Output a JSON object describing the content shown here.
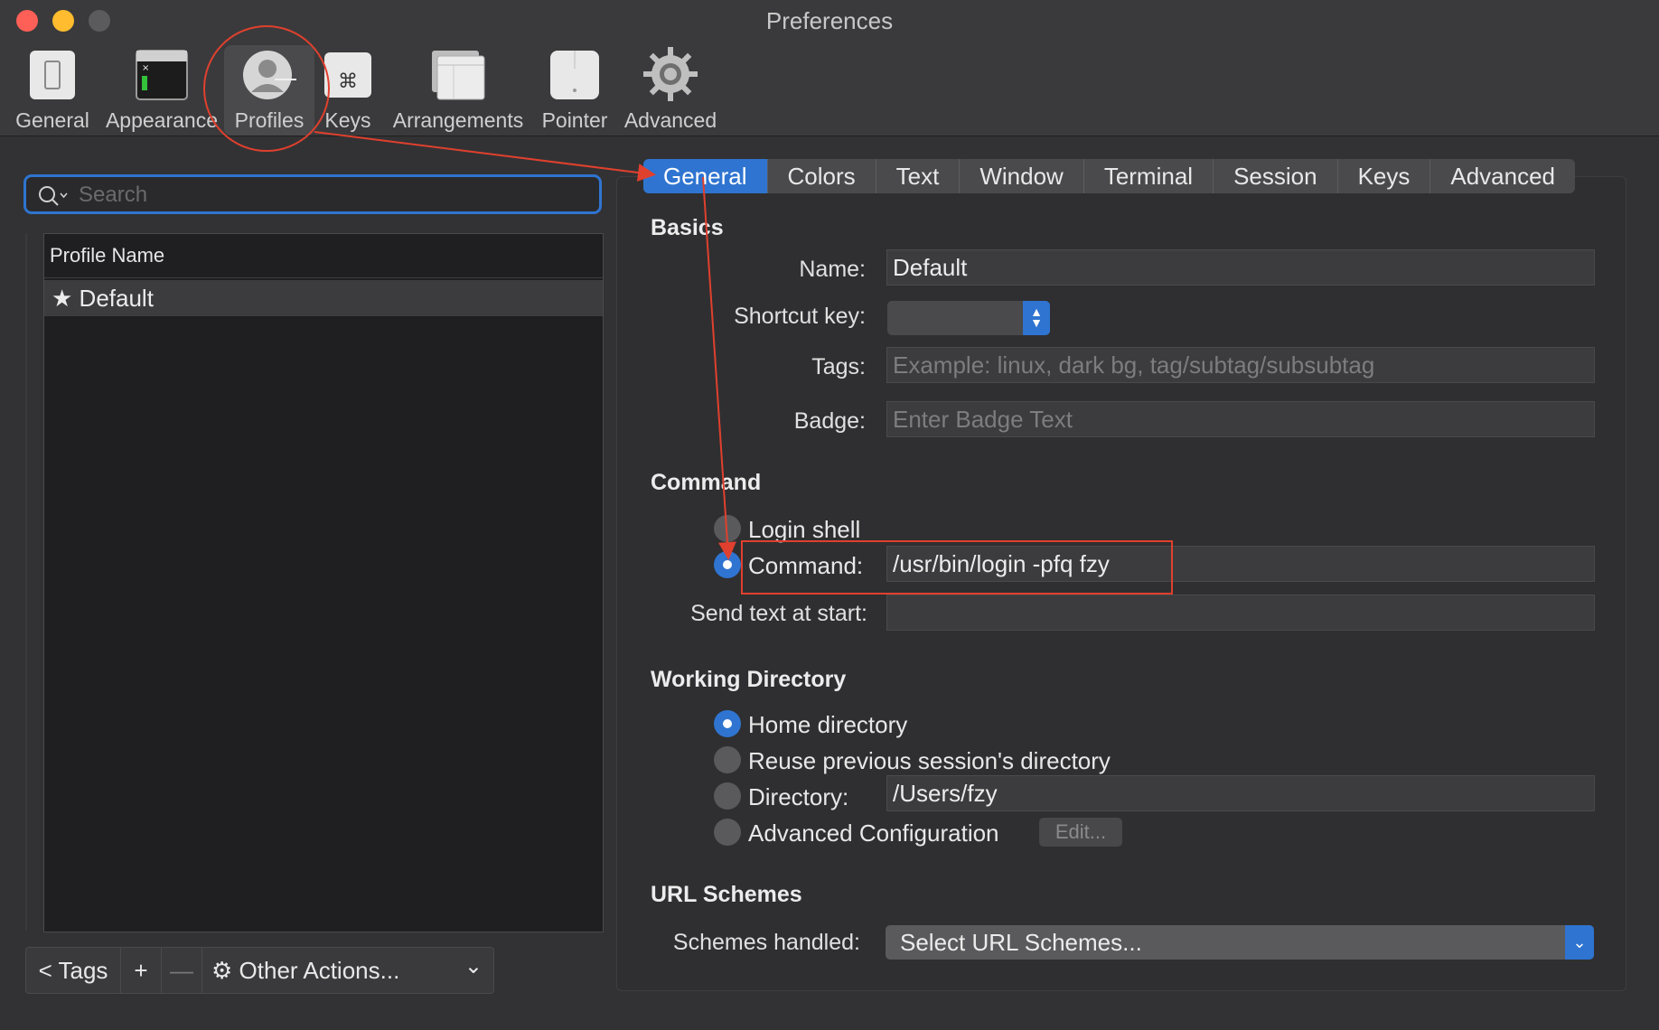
{
  "window": {
    "title": "Preferences"
  },
  "toolbar": {
    "items": [
      {
        "label": "General",
        "icon": "general-switch-icon"
      },
      {
        "label": "Appearance",
        "icon": "appearance-window-icon"
      },
      {
        "label": "Profiles",
        "icon": "profile-person-icon"
      },
      {
        "label": "Keys",
        "icon": "command-key-icon"
      },
      {
        "label": "Arrangements",
        "icon": "arrangements-windows-icon"
      },
      {
        "label": "Pointer",
        "icon": "mouse-pointer-icon"
      },
      {
        "label": "Advanced",
        "icon": "gear-icon"
      }
    ],
    "selected": "Profiles"
  },
  "sidebar": {
    "search_placeholder": "Search",
    "column_header": "Profile Name",
    "profiles": [
      {
        "name": "Default",
        "default_star": "★"
      }
    ],
    "bottom": {
      "tags_label": "< Tags",
      "add_label": "+",
      "remove_label": "—",
      "other_actions_label": "Other Actions...",
      "other_actions_chevron": "⌄"
    }
  },
  "tabs": {
    "items": [
      "General",
      "Colors",
      "Text",
      "Window",
      "Terminal",
      "Session",
      "Keys",
      "Advanced"
    ],
    "active": "General"
  },
  "basics": {
    "section_title": "Basics",
    "name_label": "Name:",
    "name_value": "Default",
    "shortcut_label": "Shortcut key:",
    "tags_label": "Tags:",
    "tags_placeholder": "Example: linux, dark bg, tag/subtag/subsubtag",
    "badge_label": "Badge:",
    "badge_placeholder": "Enter Badge Text"
  },
  "command": {
    "section_title": "Command",
    "login_shell_label": "Login shell",
    "command_label": "Command:",
    "command_value": "/usr/bin/login -pfq fzy",
    "send_text_label": "Send text at start:",
    "send_text_value": "",
    "selected": "Command"
  },
  "working_directory": {
    "section_title": "Working Directory",
    "home_label": "Home directory",
    "reuse_label": "Reuse previous session's directory",
    "directory_label": "Directory:",
    "directory_value": "/Users/fzy",
    "advanced_label": "Advanced Configuration",
    "edit_label": "Edit...",
    "selected": "Home directory"
  },
  "url_schemes": {
    "section_title": "URL Schemes",
    "label": "Schemes handled:",
    "select_value": "Select URL Schemes..."
  },
  "colors": {
    "accent": "#2f74d0",
    "annotation": "#e0402e",
    "close": "#fe5f57",
    "minimize": "#febc2e"
  }
}
